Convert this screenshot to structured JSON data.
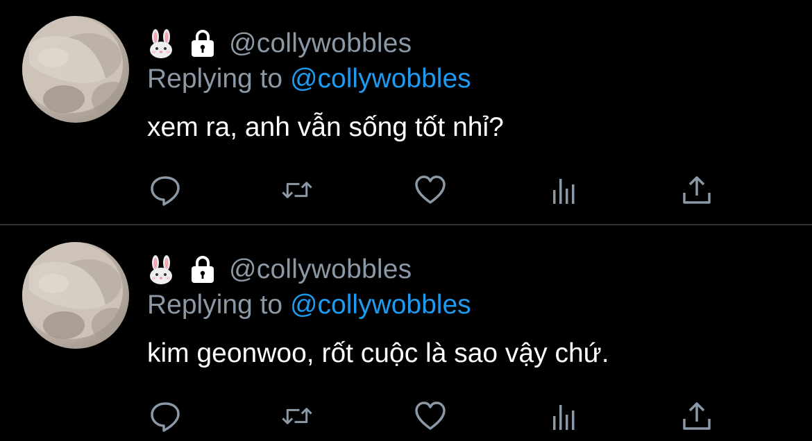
{
  "colors": {
    "background": "#000000",
    "divider": "#2f3336",
    "secondary_text": "#8b98a5",
    "mention": "#1d9bf0",
    "primary_text": "#ffffff"
  },
  "tweets": [
    {
      "author_emoji": "🐰",
      "protected_icon": "lock-icon",
      "handle": "@collywobbles",
      "replying_prefix": "Replying to ",
      "replying_to": "@collywobbles",
      "text": "xem ra, anh vẫn sống tốt nhỉ?",
      "actions": [
        "reply-icon",
        "retweet-icon",
        "like-icon",
        "stats-icon",
        "share-icon"
      ]
    },
    {
      "author_emoji": "🐰",
      "protected_icon": "lock-icon",
      "handle": "@collywobbles",
      "replying_prefix": "Replying to ",
      "replying_to": "@collywobbles",
      "text": "kim geonwoo, rốt cuộc là sao vậy chứ.",
      "actions": [
        "reply-icon",
        "retweet-icon",
        "like-icon",
        "stats-icon",
        "share-icon"
      ]
    }
  ]
}
